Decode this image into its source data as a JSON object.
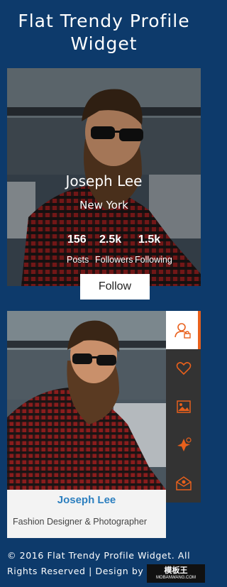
{
  "title": "Flat Trendy Profile Widget",
  "card1": {
    "name": "Joseph Lee",
    "location": "New York",
    "stats": [
      {
        "value": "156",
        "label": "Posts"
      },
      {
        "value": "2.5k",
        "label": "Followers"
      },
      {
        "value": "1.5k",
        "label": "Following"
      }
    ],
    "follow_label": "Follow"
  },
  "card2": {
    "name": "Joseph Lee",
    "role": "Fashion Designer & Photographer",
    "menu": [
      {
        "icon": "user-lock-icon",
        "active": true
      },
      {
        "icon": "heart-icon",
        "active": false
      },
      {
        "icon": "image-icon",
        "active": false
      },
      {
        "icon": "share-icon",
        "active": false
      },
      {
        "icon": "mail-icon",
        "active": false
      }
    ]
  },
  "footer": {
    "line1": "© 2016 Flat Trendy Profile Widget. All",
    "line2": "Rights Reserved | Design by"
  },
  "watermark": {
    "main": "模板王",
    "sub": "MOBANWANG.COM"
  },
  "colors": {
    "background": "#0d3a6b",
    "accent": "#e8601c",
    "name_blue": "#2c7fbf",
    "menu_bg": "#333333"
  }
}
